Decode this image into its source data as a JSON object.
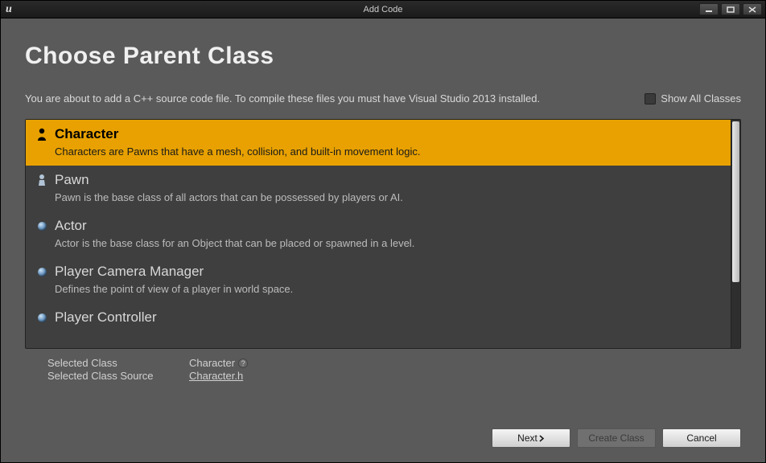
{
  "window": {
    "title": "Add Code"
  },
  "page": {
    "heading": "Choose Parent Class",
    "info": "You are about to add a C++ source code file. To compile these files you must have Visual Studio 2013 installed.",
    "show_all_label": "Show All Classes"
  },
  "classes": [
    {
      "name": "Character",
      "desc": "Characters are Pawns that have a mesh, collision, and built-in movement logic.",
      "icon": "character",
      "selected": true
    },
    {
      "name": "Pawn",
      "desc": "Pawn is the base class of all actors that can be possessed by players or AI.",
      "icon": "pawn",
      "selected": false
    },
    {
      "name": "Actor",
      "desc": "Actor is the base class for an Object that can be placed or spawned in a level.",
      "icon": "sphere",
      "selected": false
    },
    {
      "name": "Player Camera Manager",
      "desc": "Defines the point of view of a player in world space.",
      "icon": "sphere",
      "selected": false
    },
    {
      "name": "Player Controller",
      "desc": "",
      "icon": "sphere",
      "selected": false
    }
  ],
  "selected": {
    "class_label": "Selected Class",
    "class_value": "Character",
    "source_label": "Selected Class Source",
    "source_value": "Character.h"
  },
  "buttons": {
    "next": "Next",
    "create": "Create Class",
    "cancel": "Cancel"
  }
}
